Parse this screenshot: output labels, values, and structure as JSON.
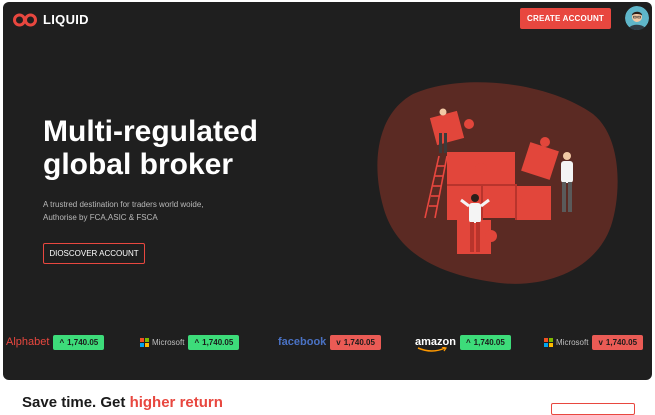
{
  "brand": {
    "name": "LIQUID",
    "accent": "#e8473f"
  },
  "header": {
    "cta_label": "CREATE ACCOUNT"
  },
  "hero": {
    "title_line1": "Multi-regulated",
    "title_line2": "global broker",
    "subtitle_line1": "A trustred destination for traders world woide,",
    "subtitle_line2": "Authorise by FCA,ASIC & FSCA",
    "button_label": "DIOSCOVER ACCOUNT"
  },
  "ticker": [
    {
      "brand": "Alphabet",
      "direction": "up",
      "value": "1,740.05"
    },
    {
      "brand": "Microsoft",
      "direction": "up",
      "value": "1,740.05"
    },
    {
      "brand": "facebook",
      "direction": "down",
      "value": "1,740.05"
    },
    {
      "brand": "amazon",
      "direction": "up",
      "value": "1,740.05"
    },
    {
      "brand": "Microsoft",
      "direction": "down",
      "value": "1,740.05"
    }
  ],
  "section": {
    "title_part1": "Save time. Get ",
    "title_highlight": "higher return"
  },
  "colors": {
    "up": "#3ddc7a",
    "down": "#ea5b55",
    "background": "#1f1f1f",
    "blob": "#5b2a23"
  }
}
